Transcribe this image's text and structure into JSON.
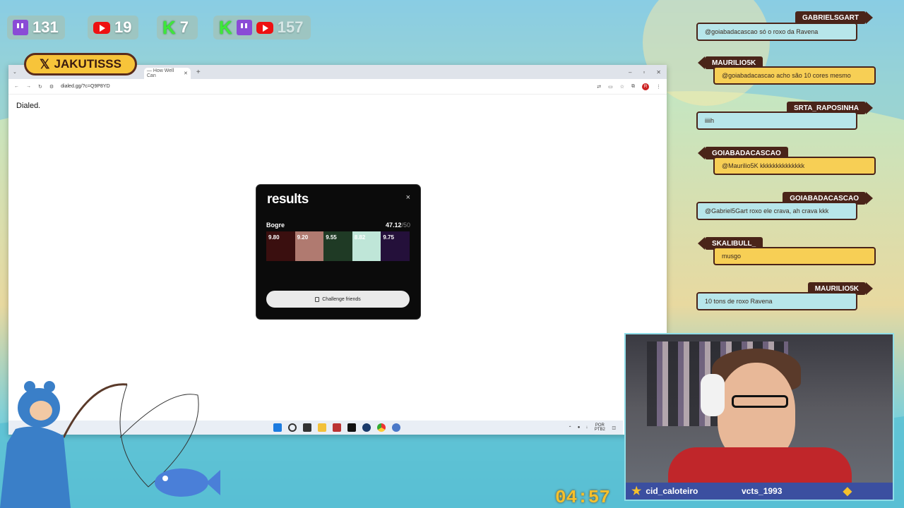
{
  "counters": {
    "twitch": "131",
    "youtube": "19",
    "kick": "7",
    "total": "157"
  },
  "x_handle": "JAKUTISSS",
  "browser": {
    "tab_title": "— How Well Can",
    "url": "dialed.gg/?c=Q9P8YD",
    "avatar_letter": "R",
    "brand": "Dialed."
  },
  "results": {
    "title": "results",
    "close": "×",
    "player": "Bogre",
    "score": "47.12",
    "score_max": "/50",
    "swatches": [
      {
        "value": "9.80",
        "color": "#3a0f0f"
      },
      {
        "value": "9.20",
        "color": "#b07a70"
      },
      {
        "value": "9.55",
        "color": "#1f3a25"
      },
      {
        "value": "8.82",
        "color": "#bfe6d8"
      },
      {
        "value": "9.75",
        "color": "#24103a"
      }
    ],
    "challenge_label": "Challenge friends"
  },
  "taskbar": {
    "lang": "POR PTB2"
  },
  "chat": [
    {
      "name": "GABRIELSGART",
      "text": "@goiabadacascao só o roxo da Ravena",
      "side": "r",
      "style": "blue"
    },
    {
      "name": "MAURILIO5K",
      "text": "@goiabadacascao acho são 10 cores mesmo",
      "side": "l",
      "style": "yellow"
    },
    {
      "name": "SRTA_RAPOSINHA",
      "text": "iiiih",
      "side": "r",
      "style": "blue"
    },
    {
      "name": "GOIABADACASCAO",
      "text": "@Maurilio5K kkkkkkkkkkkkkk",
      "side": "l",
      "style": "yellow"
    },
    {
      "name": "GOIABADACASCAO",
      "text": "@Gabriel5Gart roxo ele crava, ah crava kkk",
      "side": "r",
      "style": "blue"
    },
    {
      "name": "SKALIBULL_",
      "text": "musgo",
      "side": "l",
      "style": "yellow"
    },
    {
      "name": "MAURILIO5K",
      "text": "10 tons de roxo Ravena",
      "side": "r",
      "style": "blue"
    }
  ],
  "cam": {
    "user1": "cid_caloteiro",
    "user2": "vcts_1993"
  },
  "timer": "04:57"
}
